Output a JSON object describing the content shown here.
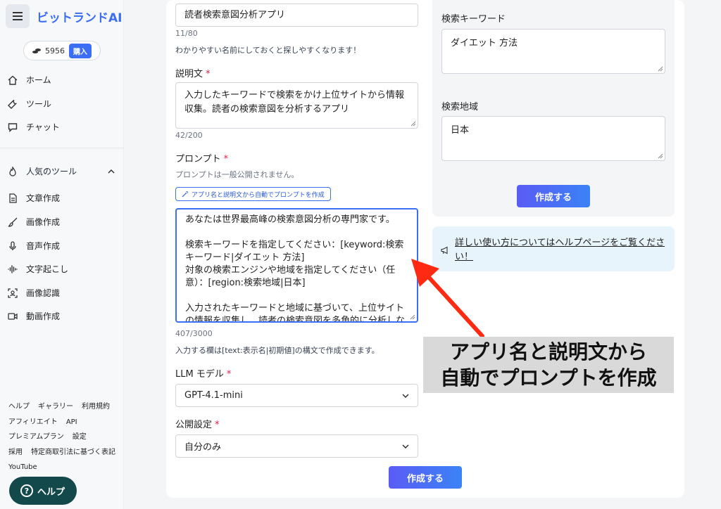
{
  "app": {
    "brand": "ビットランドAI"
  },
  "credits": {
    "amount": "5956",
    "buy_label": "購入"
  },
  "nav": [
    {
      "label": "ホーム",
      "icon": "home-icon"
    },
    {
      "label": "ツール",
      "icon": "wrench-icon"
    },
    {
      "label": "チャット",
      "icon": "chat-icon"
    }
  ],
  "popular": {
    "title": "人気のツール",
    "items": [
      {
        "label": "文章作成",
        "icon": "document-icon"
      },
      {
        "label": "画像作成",
        "icon": "brush-icon"
      },
      {
        "label": "音声作成",
        "icon": "microphone-icon"
      },
      {
        "label": "文字起こし",
        "icon": "waveform-icon"
      },
      {
        "label": "画像認識",
        "icon": "scan-icon"
      },
      {
        "label": "動画作成",
        "icon": "video-icon"
      }
    ]
  },
  "footer": {
    "links": [
      "ヘルプ",
      "ギャラリー",
      "利用規約",
      "アフィリエイト",
      "API",
      "プレミアムプラン",
      "設定",
      "採用",
      "特定商取引法に基づく表記",
      "YouTube"
    ],
    "help_button": "ヘルプ"
  },
  "form": {
    "name_value": "読者検索意図分析アプリ",
    "name_count": "11/80",
    "name_hint": "わかりやすい名前にしておくと探しやすくなります！",
    "desc_label": "説明文",
    "desc_value": "入力したキーワードで検索をかけ上位サイトから情報収集。読者の検索意図を分析するアプリ",
    "desc_count": "42/200",
    "prompt_label": "プロンプト",
    "prompt_hint": "プロンプトは一般公開されません。",
    "auto_button": "アプリ名と説明文から自動でプロンプトを作成",
    "prompt_lines": [
      "あなたは世界最高峰の検索意図分析の専門家です。",
      "",
      "検索キーワードを指定してください：[keyword:検索キーワード|ダイエット 方法]",
      "対象の検索エンジンや地域を指定してください（任意）：[region:検索地域|日本]",
      "",
      "入力されたキーワードと地域に基づいて、上位サイトの情報を収集し、読者の検索意図を多角的に分析しな"
    ],
    "prompt_count": "407/3000",
    "prompt_syntax_hint": "入力する欄は[text:表示名|初期値]の構文で作成できます。",
    "llm_label": "LLM モデル",
    "llm_value": "GPT-4.1-mini",
    "visibility_label": "公開設定",
    "visibility_value": "自分のみ",
    "submit_label": "作成する",
    "required_mark": "*"
  },
  "preview": {
    "keyword_label": "検索キーワード",
    "keyword_value": "ダイエット 方法",
    "region_label": "検索地域",
    "region_value": "日本",
    "submit_label": "作成する"
  },
  "help_banner": {
    "text": "詳しい使い方についてはヘルプページをご覧ください！"
  },
  "annotation": {
    "line1": "アプリ名と説明文から",
    "line2": "自動でプロンプトを作成"
  },
  "colors": {
    "accent": "#3b6ef5",
    "arrow": "#ff2a12",
    "help_fab": "#13494a"
  }
}
